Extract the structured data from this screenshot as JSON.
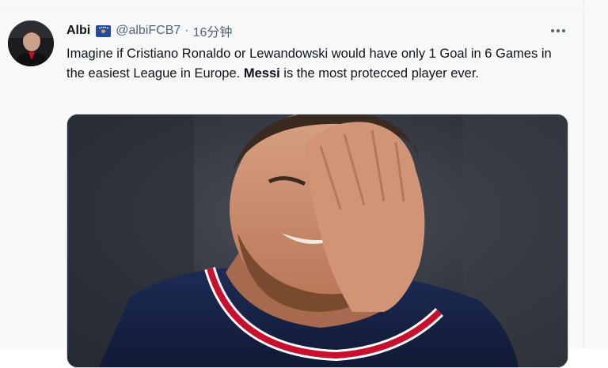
{
  "tweet": {
    "display_name": "Albi",
    "handle": "@albiFCB7",
    "separator": "·",
    "time": "16分钟",
    "text_part1": "Imagine if Cristiano Ronaldo or Lewandowski would have only 1 Goal in 6 Games in the easiest League in Europe. ",
    "text_bold": "Messi",
    "text_part2": " is the most protecced player ever."
  },
  "icons": {
    "flag": "kosovo-flag-icon",
    "more": "more-options-icon"
  },
  "colors": {
    "background": "#f7f9f9",
    "secondary_text": "#536471",
    "primary_text": "#0f1419"
  }
}
